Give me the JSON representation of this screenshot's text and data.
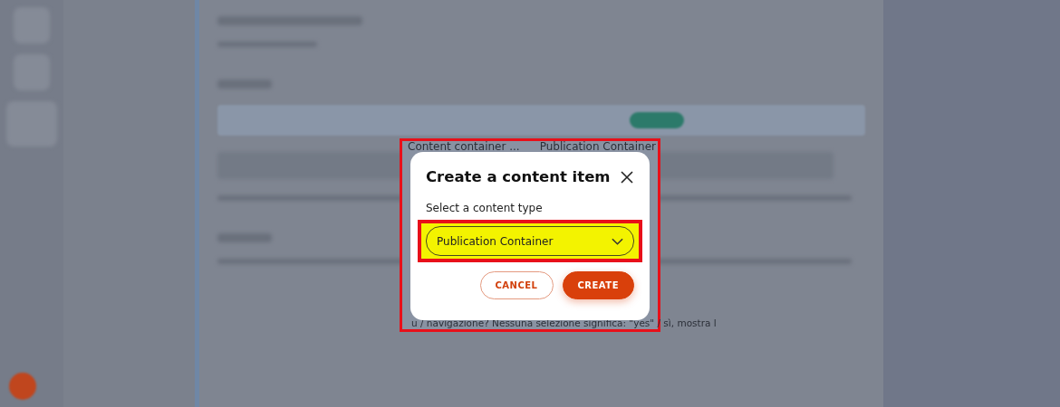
{
  "background": {
    "fragments_above": [
      "Content container ...",
      "Publication Container"
    ],
    "fragment_below": "u / navigazione? Nessuna selezione significa: \"yes\" / sì, mostra l"
  },
  "dialog": {
    "title": "Create a content item",
    "field_label": "Select a content type",
    "select": {
      "value": "Publication Container",
      "highlighted": true
    },
    "buttons": [
      {
        "label": "CANCEL",
        "kind": "secondary"
      },
      {
        "label": "CREATE",
        "kind": "primary"
      }
    ]
  }
}
